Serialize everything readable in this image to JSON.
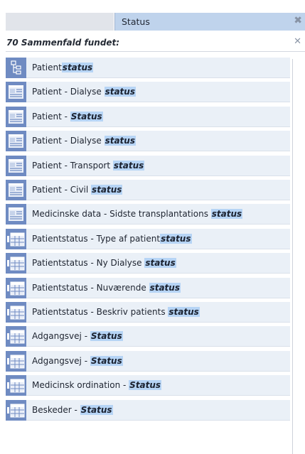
{
  "search": {
    "value": "Status",
    "clear_icon": "close-icon"
  },
  "results": {
    "title": "70 Sammenfald fundet:",
    "close_icon": "close-icon"
  },
  "colors": {
    "icon_bg": "#6f8bc2",
    "row_bg": "#eaf0f7",
    "highlight": "#b6d4f5"
  },
  "items": [
    {
      "icon": "tree-icon",
      "prefix": "Patient",
      "match": "status"
    },
    {
      "icon": "form-icon",
      "prefix": "Patient - Dialyse ",
      "match": "status"
    },
    {
      "icon": "form-icon",
      "prefix": "Patient - ",
      "match": "Status"
    },
    {
      "icon": "form-icon",
      "prefix": "Patient - Dialyse ",
      "match": "status"
    },
    {
      "icon": "form-icon",
      "prefix": "Patient - Transport ",
      "match": "status"
    },
    {
      "icon": "form-icon",
      "prefix": "Patient - Civil ",
      "match": "status"
    },
    {
      "icon": "form-icon",
      "prefix": "Medicinske data - Sidste transplantations ",
      "match": "status"
    },
    {
      "icon": "table-icon",
      "prefix": "Patientstatus - Type af patient",
      "match": "status"
    },
    {
      "icon": "table-icon",
      "prefix": "Patientstatus - Ny Dialyse ",
      "match": "status"
    },
    {
      "icon": "table-icon",
      "prefix": "Patientstatus - Nuværende ",
      "match": "status"
    },
    {
      "icon": "table-icon",
      "prefix": "Patientstatus - Beskriv patients ",
      "match": "status"
    },
    {
      "icon": "table-icon",
      "prefix": "Adgangsvej - ",
      "match": "Status"
    },
    {
      "icon": "table-icon",
      "prefix": "Adgangsvej - ",
      "match": "Status"
    },
    {
      "icon": "table-icon",
      "prefix": "Medicinsk ordination - ",
      "match": "Status"
    },
    {
      "icon": "table-icon",
      "prefix": "Beskeder - ",
      "match": "Status"
    }
  ]
}
